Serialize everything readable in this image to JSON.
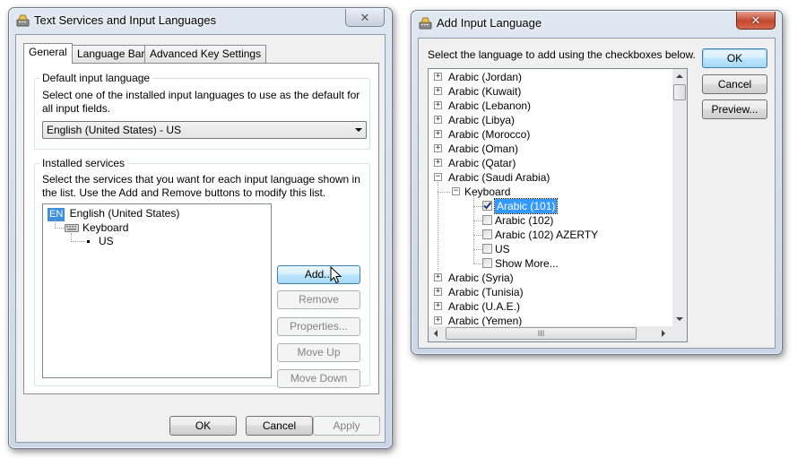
{
  "colors": {
    "selection": "#3399ff",
    "lang_badge": "#3c8fd8"
  },
  "text_services": {
    "title": "Text Services and Input Languages",
    "close_glyph": "✕",
    "tabs": [
      {
        "label": "General"
      },
      {
        "label": "Language Bar"
      },
      {
        "label": "Advanced Key Settings"
      }
    ],
    "default_group": {
      "label": "Default input language",
      "description": "Select one of the installed input languages to use as the default for all input fields.",
      "selected_value": "English (United States) - US"
    },
    "installed_group": {
      "label": "Installed services",
      "description": "Select the services that you want for each input language shown in the list. Use the Add and Remove buttons to modify this list.",
      "tree": {
        "language_badge": "EN",
        "language": "English (United States)",
        "category": "Keyboard",
        "item": "US"
      },
      "buttons": {
        "add": "Add...",
        "remove": "Remove",
        "properties": "Properties...",
        "move_up": "Move Up",
        "move_down": "Move Down"
      }
    },
    "footer": {
      "ok": "OK",
      "cancel": "Cancel",
      "apply": "Apply"
    }
  },
  "add_language": {
    "title": "Add Input Language",
    "close_glyph": "✕",
    "instruction": "Select the language to add using the checkboxes below.",
    "languages_before": [
      "Arabic (Jordan)",
      "Arabic (Kuwait)",
      "Arabic (Lebanon)",
      "Arabic (Libya)",
      "Arabic (Morocco)",
      "Arabic (Oman)",
      "Arabic (Qatar)"
    ],
    "expanded_language": "Arabic (Saudi Arabia)",
    "expanded_category": "Keyboard",
    "keyboards": [
      {
        "label": "Arabic (101)",
        "checked": true,
        "selected": true
      },
      {
        "label": "Arabic (102)",
        "checked": false,
        "selected": false
      },
      {
        "label": "Arabic (102) AZERTY",
        "checked": false,
        "selected": false
      },
      {
        "label": "US",
        "checked": false,
        "selected": false
      },
      {
        "label": "Show More...",
        "checked": false,
        "selected": false
      }
    ],
    "languages_after": [
      "Arabic (Syria)",
      "Arabic (Tunisia)",
      "Arabic (U.A.E.)",
      "Arabic (Yemen)"
    ],
    "hscroll_grip": "III",
    "buttons": {
      "ok": "OK",
      "cancel": "Cancel",
      "preview": "Preview..."
    }
  }
}
